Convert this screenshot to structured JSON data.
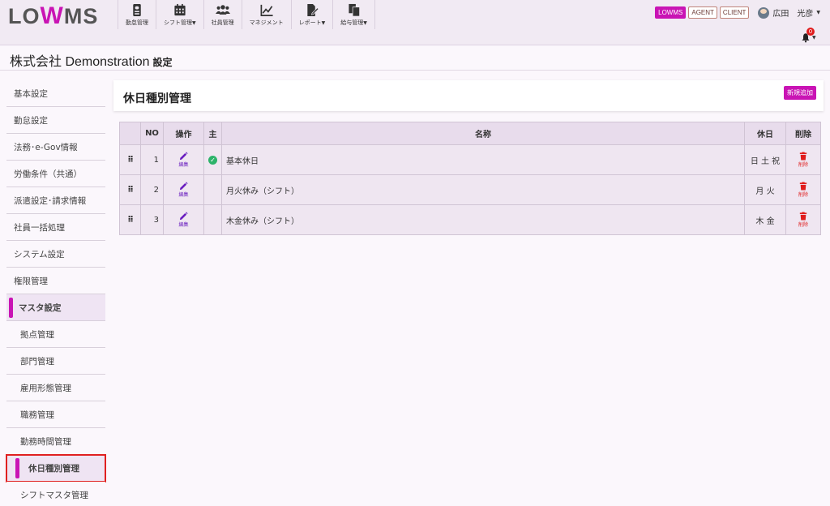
{
  "app": {
    "logo_pre": "LO",
    "logo_w": "W",
    "logo_post": "MS"
  },
  "nav": [
    {
      "label": "勤怠管理",
      "icon": "id-badge-icon",
      "caret": false
    },
    {
      "label": "シフト管理",
      "icon": "calendar-icon",
      "caret": true
    },
    {
      "label": "社員管理",
      "icon": "users-icon",
      "caret": false
    },
    {
      "label": "マネジメント",
      "icon": "chart-line-icon",
      "caret": false
    },
    {
      "label": "レポート",
      "icon": "file-edit-icon",
      "caret": true
    },
    {
      "label": "給与管理",
      "icon": "copy-icon",
      "caret": true
    }
  ],
  "header_right": {
    "modes": [
      "LOWMS",
      "AGENT",
      "CLIENT"
    ],
    "active_mode": "LOWMS",
    "user_name": "広田　光彦",
    "notification_count": "0"
  },
  "page": {
    "company": "株式会社 Demonstration",
    "section": "設定"
  },
  "sidebar": {
    "items": [
      {
        "label": "基本設定"
      },
      {
        "label": "勤怠設定"
      },
      {
        "label": "法務･e-Gov情報"
      },
      {
        "label": "労働条件（共通）"
      },
      {
        "label": "派遣設定･請求情報"
      },
      {
        "label": "社員一括処理"
      },
      {
        "label": "システム設定"
      },
      {
        "label": "権限管理"
      },
      {
        "label": "マスタ設定"
      }
    ],
    "subitems": [
      {
        "label": "拠点管理"
      },
      {
        "label": "部門管理"
      },
      {
        "label": "雇用形態管理"
      },
      {
        "label": "職務管理"
      },
      {
        "label": "勤務時間管理"
      },
      {
        "label": "休日種別管理"
      },
      {
        "label": "シフトマスタ管理"
      }
    ]
  },
  "panel": {
    "title": "休日種別管理",
    "add_label": "新規追加"
  },
  "table": {
    "headers": {
      "no": "NO",
      "op": "操作",
      "main": "主",
      "name": "名称",
      "holiday": "休日",
      "delete": "削除"
    },
    "edit_label": "編集",
    "delete_label": "削除",
    "rows": [
      {
        "no": "1",
        "main": true,
        "name": "基本休日",
        "holiday": "日 土 祝"
      },
      {
        "no": "2",
        "main": false,
        "name": "月火休み（シフト）",
        "holiday": "月 火"
      },
      {
        "no": "3",
        "main": false,
        "name": "木金休み（シフト）",
        "holiday": "木 金"
      }
    ]
  },
  "colors": {
    "accent": "#c914b4",
    "edit": "#6a1fbf",
    "delete": "#e01c1c",
    "main_check": "#2db36a"
  }
}
